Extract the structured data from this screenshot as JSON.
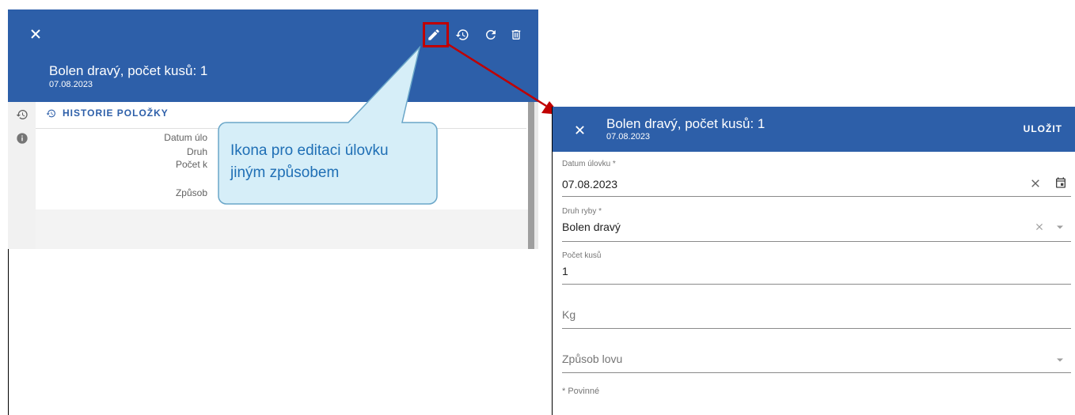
{
  "left_panel": {
    "title": "Bolen dravý, počet kusů: 1",
    "date": "07.08.2023",
    "history_header": "HISTORIE POLOŽKY",
    "detail_labels": [
      "Datum úlo",
      "Druh",
      "Počet k",
      "Způsob"
    ]
  },
  "callout": {
    "line1": "Ikona pro editaci úlovku",
    "line2": "jiným způsobem"
  },
  "right_panel": {
    "title": "Bolen dravý, počet kusů: 1",
    "date": "07.08.2023",
    "save_label": "ULOŽIT",
    "fields": {
      "date_label": "Datum úlovku *",
      "date_value": "07.08.2023",
      "species_label": "Druh ryby *",
      "species_value": "Bolen dravý",
      "count_label": "Počet kusů",
      "count_value": "1",
      "kg_placeholder": "Kg",
      "method_placeholder": "Způsob lovu"
    },
    "required_note": "* Povinné"
  },
  "colors": {
    "header_blue": "#2d5fa9",
    "highlight_red": "#c00000",
    "callout_fill": "#d6eef8",
    "callout_text": "#1f6fb5"
  },
  "icons": [
    "close-icon",
    "edit-icon",
    "history-icon",
    "refresh-icon",
    "delete-icon",
    "info-icon",
    "calendar-icon",
    "clear-icon",
    "dropdown-arrow-icon"
  ]
}
